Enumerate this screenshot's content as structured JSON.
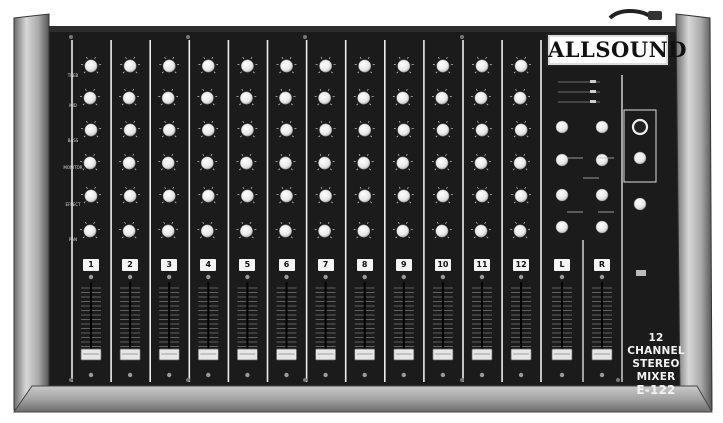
{
  "photo": {
    "brand": "ALLSOUND",
    "model_line1": "12 CHANNEL",
    "model_line2": "STEREO MIXER",
    "model_line3": "E-122",
    "channel_labels": [
      "1",
      "2",
      "3",
      "4",
      "5",
      "6",
      "7",
      "8",
      "9",
      "10",
      "11",
      "12"
    ],
    "master_labels": [
      "L",
      "R"
    ],
    "row_labels": [
      "TREB",
      "MID",
      "BASS",
      "MONITOR",
      "EFFECT",
      "PAN"
    ],
    "colors": {
      "panel": "#1b1b1b",
      "knob": "#f1f1f1",
      "metal_frame": "#9d9d9d",
      "strip_line": "#ececec"
    }
  }
}
